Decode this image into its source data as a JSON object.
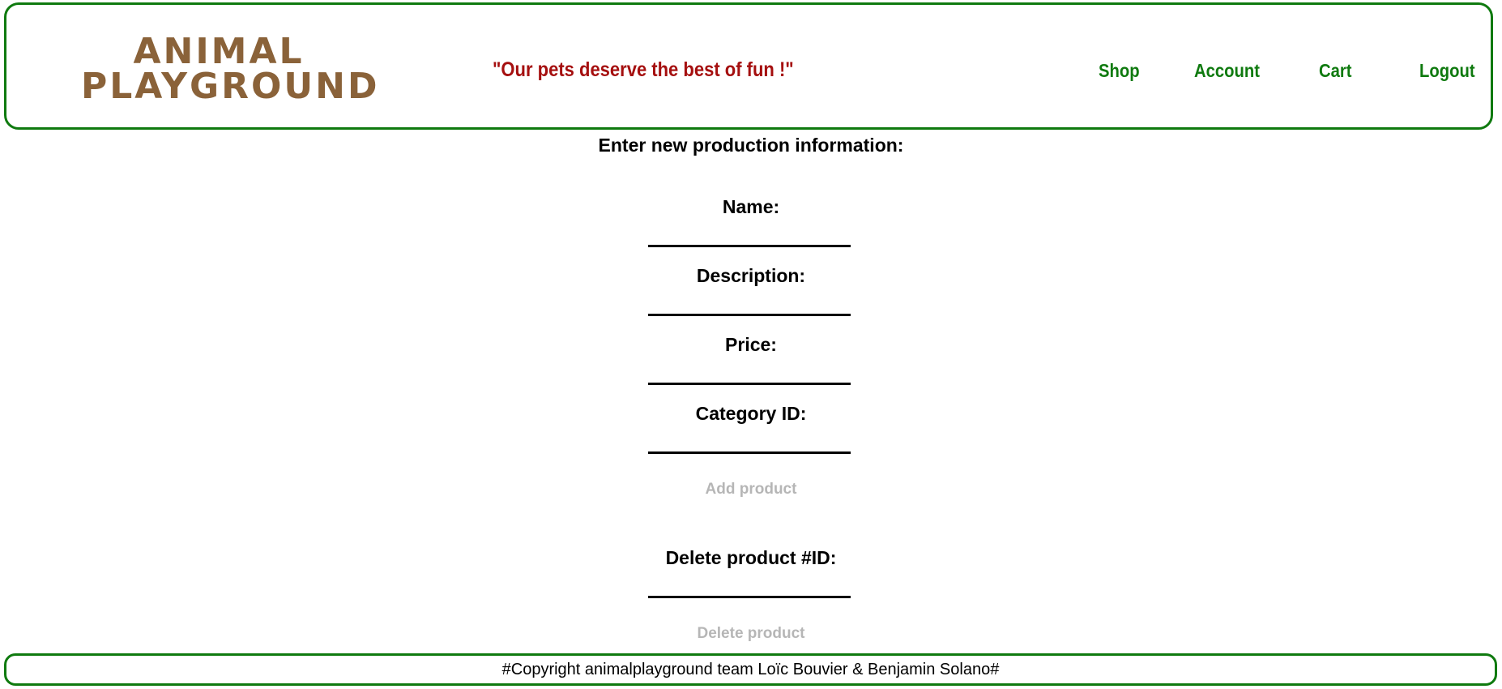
{
  "header": {
    "logo_line1": "ANIMAL",
    "logo_line2": "PLAYGROUND",
    "slogan": "\"Our pets deserve the best of fun !\"",
    "nav": {
      "shop": "Shop",
      "account": "Account",
      "cart": "Cart",
      "logout": "Logout"
    }
  },
  "form": {
    "title": "Enter new production information:",
    "name_label": "Name:",
    "description_label": "Description:",
    "price_label": "Price:",
    "category_label": "Category ID:",
    "add_button": "Add product",
    "delete_label": "Delete product #ID:",
    "delete_button": "Delete product"
  },
  "footer": {
    "text": "#Copyright animalplayground team Loïc Bouvier & Benjamin Solano#"
  },
  "colors": {
    "accent_green": "#0f7a0f",
    "logo_brown": "#8a6239",
    "slogan_red": "#a50f0f",
    "disabled_gray": "#b6b6b6"
  }
}
